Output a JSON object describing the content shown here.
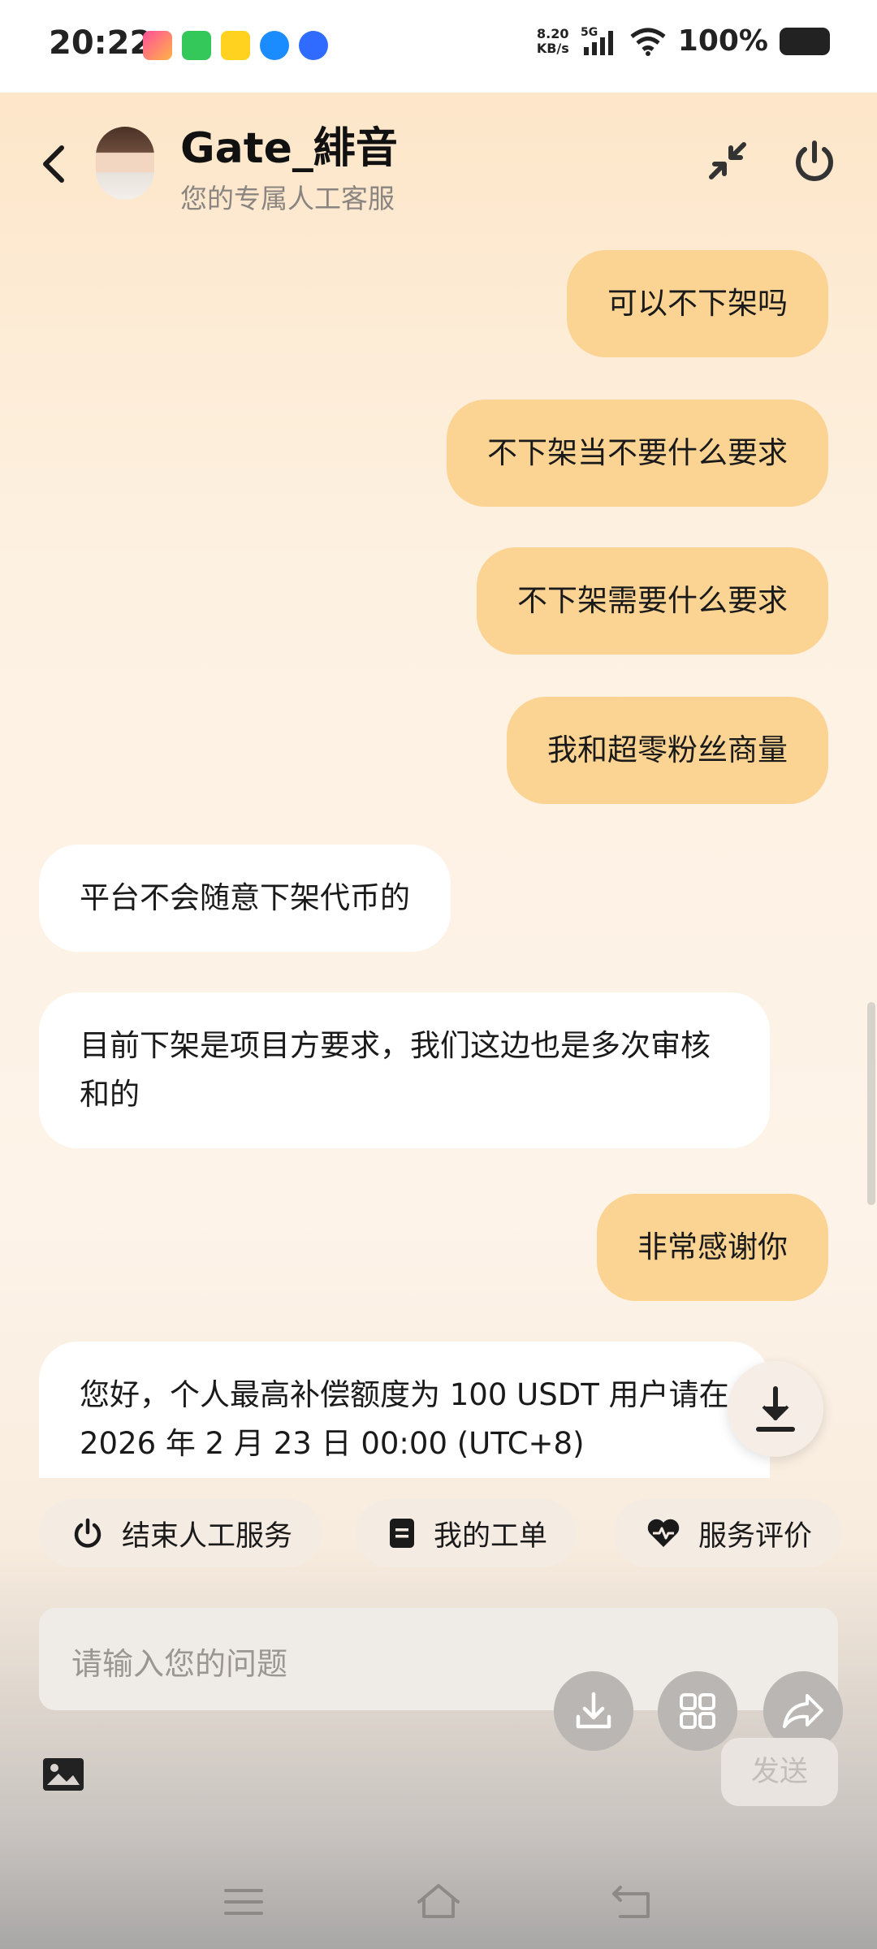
{
  "status_bar": {
    "time": "20:22",
    "speed_value": "8.20",
    "speed_unit": "KB/s",
    "network": "5G",
    "battery": "100%"
  },
  "header": {
    "name": "Gate_緋音",
    "subtitle": "您的专属人工客服"
  },
  "messages": [
    {
      "from": "user",
      "text": "可以不下架吗"
    },
    {
      "from": "user",
      "text": "不下架当不要什么要求"
    },
    {
      "from": "user",
      "text": "不下架需要什么要求"
    },
    {
      "from": "user",
      "text": "我和超零粉丝商量"
    },
    {
      "from": "agent",
      "text": "平台不会随意下架代币的"
    },
    {
      "from": "agent",
      "text": "目前下架是项目方要求，我们这边也是多次审核和的"
    },
    {
      "from": "user",
      "text": "非常感谢你"
    },
    {
      "from": "agent",
      "text": "您好，个人最高补偿额度为 100 USDT 用户请在 2026 年 2 月 23 日 00:00 (UTC+8)"
    }
  ],
  "quick_actions": [
    {
      "label": "结束人工服务",
      "icon": "power-icon"
    },
    {
      "label": "我的工单",
      "icon": "document-icon"
    },
    {
      "label": "服务评价",
      "icon": "heart-icon"
    }
  ],
  "input": {
    "placeholder": "请输入您的问题",
    "send_label": "发送"
  },
  "colors": {
    "user_bubble": "#fbd494",
    "agent_bubble": "#ffffff",
    "header_bg": "#fde4c4"
  }
}
